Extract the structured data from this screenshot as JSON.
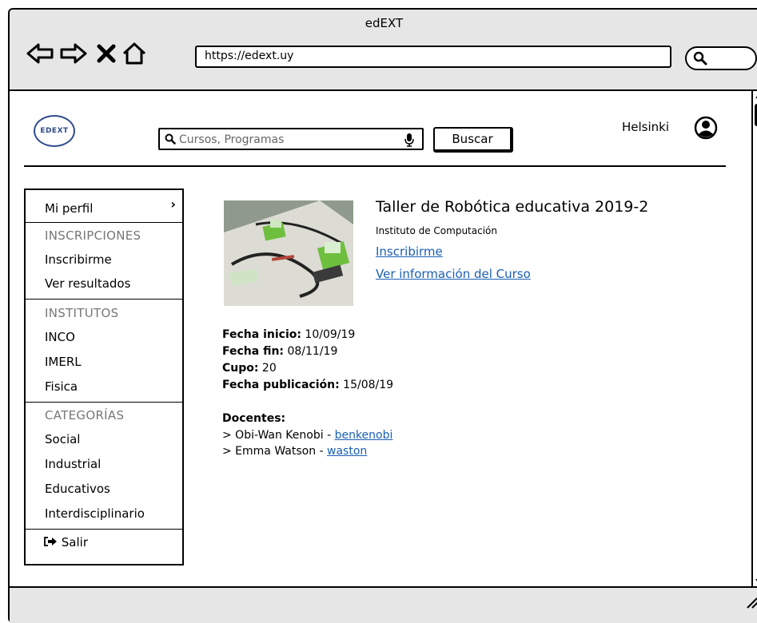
{
  "window": {
    "title": "edEXT"
  },
  "browser": {
    "url": "https://edext.uy"
  },
  "header": {
    "logo_text": "EDEXT",
    "search_placeholder": "Cursos, Programas",
    "search_button": "Buscar",
    "user_name": "Helsinki"
  },
  "sidebar": {
    "profile": "Mi perfil",
    "inscripciones_header": "INSCRIPCIONES",
    "inscribirme": "Inscribirme",
    "ver_resultados": "Ver resultados",
    "institutos_header": "INSTITUTOS",
    "institutos": [
      "INCO",
      "IMERL",
      "Fisica"
    ],
    "categorias_header": "CATEGORÍAS",
    "categorias": [
      "Social",
      "Industrial",
      "Educativos",
      "Interdisciplinario"
    ],
    "salir": "Salir"
  },
  "course": {
    "title": "Taller de Robótica educativa 2019-2",
    "institute": "Instituto de Computación",
    "enroll_link": "Inscribirme",
    "info_link": "Ver información del Curso",
    "fecha_inicio_label": "Fecha inicio:",
    "fecha_inicio": " 10/09/19",
    "fecha_fin_label": "Fecha fin:",
    "fecha_fin": " 08/11/19",
    "cupo_label": "Cupo:",
    "cupo": " 20",
    "fecha_pub_label": "Fecha publicación:",
    "fecha_pub": " 15/08/19",
    "docentes_label": "Docentes:",
    "docentes": [
      {
        "prefix": "> Obi-Wan Kenobi - ",
        "user": "benkenobi"
      },
      {
        "prefix": "> Emma Watson - ",
        "user": "waston"
      }
    ]
  }
}
